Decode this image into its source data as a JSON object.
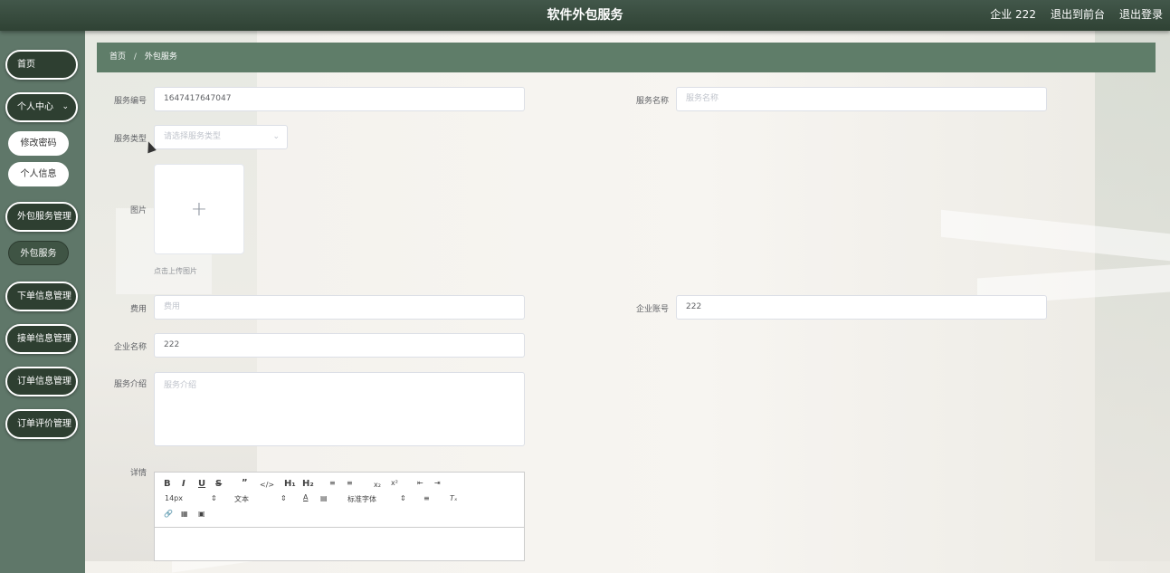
{
  "header": {
    "title": "软件外包服务",
    "user_label": "企业 222",
    "front_label": "退出到前台",
    "logout_label": "退出登录"
  },
  "sidebar": {
    "home": "首页",
    "personal_center": "个人中心",
    "change_password": "修改密码",
    "personal_info": "个人信息",
    "outsource_mgmt": "外包服务管理",
    "outsource_service": "外包服务",
    "order_info_mgmt": "下单信息管理",
    "accept_order_mgmt": "接单信息管理",
    "order_mgmt": "订单信息管理",
    "order_review_mgmt": "订单评价管理"
  },
  "breadcrumb": {
    "home": "首页",
    "separator": "/",
    "current": "外包服务"
  },
  "form": {
    "service_no": {
      "label": "服务编号",
      "value": "1647417647047"
    },
    "service_name": {
      "label": "服务名称",
      "placeholder": "服务名称"
    },
    "service_type": {
      "label": "服务类型",
      "placeholder": "请选择服务类型"
    },
    "image": {
      "label": "图片",
      "hint": "点击上传图片"
    },
    "fee": {
      "label": "费用",
      "placeholder": "费用"
    },
    "company_account": {
      "label": "企业账号",
      "value": "222"
    },
    "company_name": {
      "label": "企业名称",
      "value": "222"
    },
    "service_intro": {
      "label": "服务介绍",
      "placeholder": "服务介绍"
    },
    "details": {
      "label": "详情"
    }
  },
  "editor": {
    "font_size": "14px",
    "text_style": "文本",
    "font_family": "标准字体"
  },
  "colors": {
    "topbar": "#2f4234",
    "breadcrumb": "#5f7d69",
    "sidebar_bg": "#5f7769",
    "menu_button": "#2e3f31"
  }
}
